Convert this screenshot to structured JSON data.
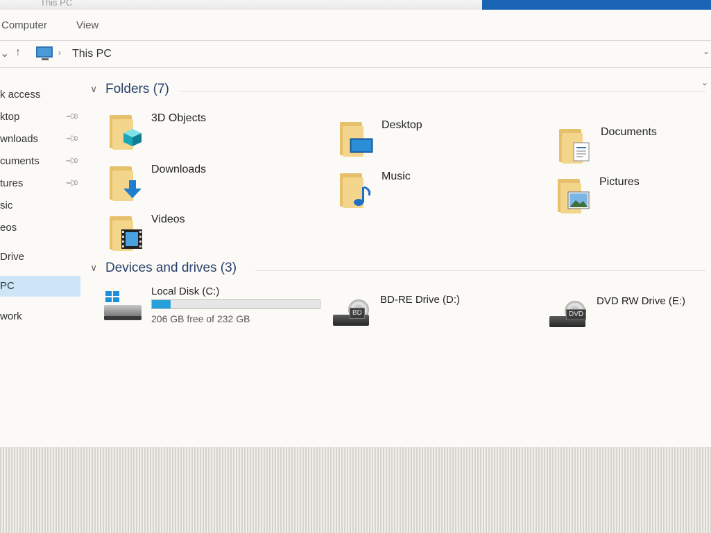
{
  "window": {
    "title": "This PC"
  },
  "ribbon": {
    "tabs": [
      "Computer",
      "View"
    ]
  },
  "address": {
    "back": "⌄",
    "up": "↑",
    "separator": "›",
    "path": "This PC",
    "scroll": "⌄"
  },
  "sidebar": {
    "items": [
      {
        "label": "k access",
        "pinned": false
      },
      {
        "label": "ktop",
        "pinned": true
      },
      {
        "label": "wnloads",
        "pinned": true
      },
      {
        "label": "cuments",
        "pinned": true
      },
      {
        "label": "tures",
        "pinned": true
      },
      {
        "label": "sic",
        "pinned": false
      },
      {
        "label": "eos",
        "pinned": false
      },
      {
        "label": "Drive",
        "pinned": false
      },
      {
        "label": "PC",
        "pinned": false,
        "selected": true
      },
      {
        "label": "work",
        "pinned": false
      }
    ]
  },
  "folders_section": {
    "title": "Folders (7)"
  },
  "folders": [
    {
      "name": "3D Objects",
      "icon": "cube-icon"
    },
    {
      "name": "Desktop",
      "icon": "monitor-icon"
    },
    {
      "name": "Documents",
      "icon": "document-icon"
    },
    {
      "name": "Downloads",
      "icon": "download-arrow-icon"
    },
    {
      "name": "Music",
      "icon": "music-note-icon"
    },
    {
      "name": "Pictures",
      "icon": "picture-icon"
    },
    {
      "name": "Videos",
      "icon": "film-icon"
    }
  ],
  "drives_section": {
    "title": "Devices and drives (3)"
  },
  "drives": [
    {
      "name": "Local Disk (C:)",
      "free_text": "206 GB free of 232 GB",
      "used_fraction": 0.112,
      "icon": "hard-disk-icon"
    },
    {
      "name": "BD-RE Drive (D:)",
      "tag": "BD",
      "icon": "bd-drive-icon"
    },
    {
      "name": "DVD RW Drive (E:)",
      "tag": "DVD",
      "icon": "dvd-drive-icon"
    }
  ],
  "colors": {
    "accent": "#26a0da",
    "selected_bg": "#cde6f7",
    "header_text": "#27406a",
    "folder": "#f3d58b"
  }
}
